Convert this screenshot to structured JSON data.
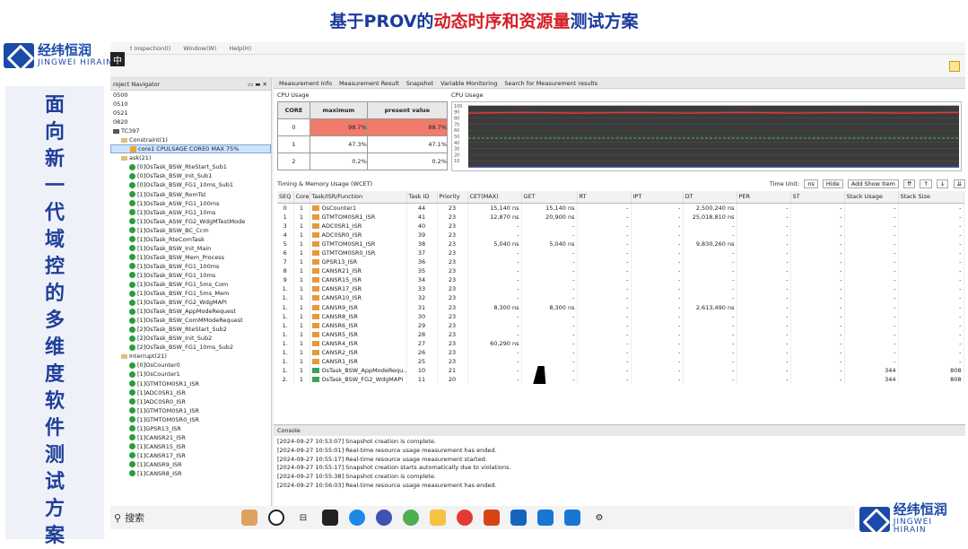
{
  "banner": {
    "part1": "基于PROV的",
    "part2": "动态时序和资源量",
    "part3": "测试方案"
  },
  "logo": {
    "cn": "经纬恒润",
    "en": "JINGWEI HIRAIN"
  },
  "ime": "中",
  "side_title": [
    "面",
    "向",
    "新",
    "一",
    "代",
    "域",
    "控",
    "的",
    "多",
    "维",
    "度",
    "软",
    "件",
    "测",
    "试",
    "方",
    "案"
  ],
  "menubar": [
    "t Inspection(I)",
    "Window(W)",
    "Help(H)"
  ],
  "navigator": {
    "title": "roject Navigator",
    "items": [
      {
        "label": "0500",
        "indent": 0,
        "icon": "none"
      },
      {
        "label": "0510",
        "indent": 0,
        "icon": "none"
      },
      {
        "label": "0521",
        "indent": 0,
        "icon": "none"
      },
      {
        "label": "0820",
        "indent": 0,
        "icon": "none"
      },
      {
        "label": "TC397",
        "indent": 0,
        "icon": "chip"
      },
      {
        "label": "Constraint(1)",
        "indent": 1,
        "icon": "folder"
      },
      {
        "label": "core1 CPULSAGE CORE0 MAX 75%",
        "indent": 2,
        "icon": "warn",
        "selected": true
      },
      {
        "label": "ask(21)",
        "indent": 1,
        "icon": "folder"
      },
      {
        "label": "[0]OsTask_BSW_RteStart_Sub1",
        "indent": 2,
        "icon": "check"
      },
      {
        "label": "[0]OsTask_BSW_Init_Sub1",
        "indent": 2,
        "icon": "check"
      },
      {
        "label": "[0]OsTask_BSW_FG1_10ms_Sub1",
        "indent": 2,
        "icon": "check"
      },
      {
        "label": "[1]OsTask_BSW_RomTst",
        "indent": 2,
        "icon": "check"
      },
      {
        "label": "[1]OsTask_ASW_FG1_100ms",
        "indent": 2,
        "icon": "check"
      },
      {
        "label": "[1]OsTask_ASW_FG1_10ms",
        "indent": 2,
        "icon": "check"
      },
      {
        "label": "[1]OsTask_ASW_FG2_WdgMTestMode",
        "indent": 2,
        "icon": "check"
      },
      {
        "label": "[1]OsTask_BSW_BC_Ccm",
        "indent": 2,
        "icon": "check"
      },
      {
        "label": "[1]OsTask_RteComTask",
        "indent": 2,
        "icon": "check"
      },
      {
        "label": "[1]OsTask_BSW_Init_Main",
        "indent": 2,
        "icon": "check"
      },
      {
        "label": "[1]OsTask_BSW_Mem_Process",
        "indent": 2,
        "icon": "check"
      },
      {
        "label": "[1]OsTask_BSW_FG1_100ms",
        "indent": 2,
        "icon": "check"
      },
      {
        "label": "[1]OsTask_BSW_FG1_10ms",
        "indent": 2,
        "icon": "check"
      },
      {
        "label": "[1]OsTask_BSW_FG1_5ms_Com",
        "indent": 2,
        "icon": "check"
      },
      {
        "label": "[1]OsTask_BSW_FG1_5ms_Mem",
        "indent": 2,
        "icon": "check"
      },
      {
        "label": "[1]OsTask_BSW_FG2_WdgMAPI",
        "indent": 2,
        "icon": "check"
      },
      {
        "label": "[1]OsTask_BSW_AppModeRequest",
        "indent": 2,
        "icon": "check"
      },
      {
        "label": "[1]OsTask_BSW_ComMModeRequest",
        "indent": 2,
        "icon": "check"
      },
      {
        "label": "[2]OsTask_BSW_RteStart_Sub2",
        "indent": 2,
        "icon": "check"
      },
      {
        "label": "[2]OsTask_BSW_Init_Sub2",
        "indent": 2,
        "icon": "check"
      },
      {
        "label": "[2]OsTask_BSW_FG1_10ms_Sub2",
        "indent": 2,
        "icon": "check"
      },
      {
        "label": "Interrupt(21)",
        "indent": 1,
        "icon": "folder"
      },
      {
        "label": "[0]OsCounter0",
        "indent": 2,
        "icon": "check"
      },
      {
        "label": "[1]OsCounter1",
        "indent": 2,
        "icon": "check"
      },
      {
        "label": "[1]GTMTOM0SR1_ISR",
        "indent": 2,
        "icon": "check"
      },
      {
        "label": "[1]ADC0SR1_ISR",
        "indent": 2,
        "icon": "check"
      },
      {
        "label": "[1]ADC0SR0_ISR",
        "indent": 2,
        "icon": "check"
      },
      {
        "label": "[1]GTMTOM0SR1_ISR",
        "indent": 2,
        "icon": "check"
      },
      {
        "label": "[1]GTMTOM0SR0_ISR",
        "indent": 2,
        "icon": "check"
      },
      {
        "label": "[1]GPSR13_ISR",
        "indent": 2,
        "icon": "check"
      },
      {
        "label": "[1]CANSR21_ISR",
        "indent": 2,
        "icon": "check"
      },
      {
        "label": "[1]CANSR15_ISR",
        "indent": 2,
        "icon": "check"
      },
      {
        "label": "[1]CANSR17_ISR",
        "indent": 2,
        "icon": "check"
      },
      {
        "label": "[1]CANSR9_ISR",
        "indent": 2,
        "icon": "check"
      },
      {
        "label": "[1]CANSR8_ISR",
        "indent": 2,
        "icon": "check"
      }
    ]
  },
  "tabs": [
    "Measurement Info",
    "Measurement Result",
    "Snapshot",
    "Variable Monitoring",
    "Search for Measurement results"
  ],
  "cpu_usage": {
    "title": "CPU Usage",
    "headers": [
      "CORE",
      "maximum",
      "present value"
    ],
    "rows": [
      {
        "core": "0",
        "max": "98.7%",
        "present": "88.7%",
        "alert": true
      },
      {
        "core": "1",
        "max": "47.3%",
        "present": "47.1%",
        "alert": false
      },
      {
        "core": "2",
        "max": "0.2%",
        "present": "0.2%",
        "alert": false
      }
    ]
  },
  "cpu_chart": {
    "title": "CPU Usage",
    "yticks": [
      "100",
      "90",
      "80",
      "70",
      "60",
      "50",
      "40",
      "30",
      "20",
      "10"
    ]
  },
  "chart_data": {
    "type": "line",
    "ylim": [
      0,
      100
    ],
    "series": [
      {
        "values": [
          88,
          89,
          88,
          89,
          88,
          89,
          88,
          89,
          88,
          89
        ]
      },
      {
        "values": [
          47,
          47,
          47,
          47,
          47,
          47,
          47,
          47,
          47,
          47
        ]
      },
      {
        "values": [
          0,
          0,
          0,
          0,
          0,
          0,
          0,
          0,
          0,
          0
        ]
      }
    ],
    "colors": [
      "#e53935",
      "#43a047",
      "#3949ab"
    ]
  },
  "wcet": {
    "title": "Timing & Memory Usage (WCET)",
    "time_unit_label": "Time Unit:",
    "time_unit": "ns",
    "hide_label": "Hide",
    "add_show_label": "Add Show Item",
    "headers": [
      "SEQ",
      "Core",
      "Task/ISR/Function",
      "Task ID",
      "Priority",
      "CET(MAX)",
      "GET",
      "RT",
      "IPT",
      "DT",
      "PER",
      "ST",
      "Stack Usage",
      "Stack Size"
    ],
    "rows": [
      [
        "0",
        "1",
        "OsCounter1",
        "44",
        "23",
        "15,140 ns",
        "15,140 ns",
        "-",
        "-",
        "2,500,240 ns",
        "-",
        "-",
        "-",
        "-"
      ],
      [
        "1",
        "1",
        "GTMTOM0SR1_ISR",
        "41",
        "23",
        "12,870 ns",
        "20,900 ns",
        "-",
        "-",
        "25,018,810 ns",
        "-",
        "-",
        "-",
        "-"
      ],
      [
        "3",
        "1",
        "ADC0SR1_ISR",
        "40",
        "23",
        "-",
        "-",
        "-",
        "-",
        "-",
        "-",
        "-",
        "-",
        "-"
      ],
      [
        "4",
        "1",
        "ADC0SR0_ISR",
        "39",
        "23",
        "-",
        "-",
        "-",
        "-",
        "-",
        "-",
        "-",
        "-",
        "-"
      ],
      [
        "5",
        "1",
        "GTMTOM0SR1_ISR",
        "38",
        "23",
        "5,040 ns",
        "5,040 ns",
        "-",
        "-",
        "9,830,260 ns",
        "-",
        "-",
        "-",
        "-"
      ],
      [
        "6",
        "1",
        "GTMTOM0SR0_ISR",
        "37",
        "23",
        "-",
        "-",
        "-",
        "-",
        "-",
        "-",
        "-",
        "-",
        "-"
      ],
      [
        "7",
        "1",
        "GPSR13_ISR",
        "36",
        "23",
        "-",
        "-",
        "-",
        "-",
        "-",
        "-",
        "-",
        "-",
        "-"
      ],
      [
        "8",
        "1",
        "CANSR21_ISR",
        "35",
        "23",
        "-",
        "-",
        "-",
        "-",
        "-",
        "-",
        "-",
        "-",
        "-"
      ],
      [
        "9",
        "1",
        "CANSR15_ISR",
        "34",
        "23",
        "-",
        "-",
        "-",
        "-",
        "-",
        "-",
        "-",
        "-",
        "-"
      ],
      [
        "1.",
        "1",
        "CANSR17_ISR",
        "33",
        "23",
        "-",
        "-",
        "-",
        "-",
        "-",
        "-",
        "-",
        "-",
        "-"
      ],
      [
        "1.",
        "1",
        "CANSR10_ISR",
        "32",
        "23",
        "-",
        "-",
        "-",
        "-",
        "-",
        "-",
        "-",
        "-",
        "-"
      ],
      [
        "1.",
        "1",
        "CANSR9_ISR",
        "31",
        "23",
        "8,300 ns",
        "8,300 ns",
        "-",
        "-",
        "2,613,490 ns",
        "-",
        "-",
        "-",
        "-"
      ],
      [
        "1.",
        "1",
        "CANSR8_ISR",
        "30",
        "23",
        "-",
        "-",
        "-",
        "-",
        "-",
        "-",
        "-",
        "-",
        "-"
      ],
      [
        "1.",
        "1",
        "CANSR6_ISR",
        "29",
        "23",
        "-",
        "-",
        "-",
        "-",
        "-",
        "-",
        "-",
        "-",
        "-"
      ],
      [
        "1.",
        "1",
        "CANSR5_ISR",
        "28",
        "23",
        "-",
        "-",
        "-",
        "-",
        "-",
        "-",
        "-",
        "-",
        "-"
      ],
      [
        "1.",
        "1",
        "CANSR4_ISR",
        "27",
        "23",
        "60,290 ns",
        "-",
        "-",
        "-",
        "-",
        "-",
        "-",
        "-",
        "-"
      ],
      [
        "1.",
        "1",
        "CANSR2_ISR",
        "26",
        "23",
        "-",
        "-",
        "-",
        "-",
        "-",
        "-",
        "-",
        "-",
        "-"
      ],
      [
        "1.",
        "1",
        "CANSR1_ISR",
        "25",
        "23",
        "-",
        "-",
        "-",
        "-",
        "-",
        "-",
        "-",
        "-",
        "-"
      ],
      [
        "1.",
        "1",
        "OsTask_BSW_AppModeRequ...",
        "10",
        "21",
        "-",
        "-",
        "-",
        "-",
        "-",
        "-",
        "-",
        "344",
        "808"
      ],
      [
        "2.",
        "1",
        "OsTask_BSW_FG2_WdgMAPI",
        "11",
        "20",
        "-",
        "-",
        "-",
        "-",
        "-",
        "-",
        "-",
        "344",
        "808"
      ]
    ]
  },
  "console": {
    "title": "Console",
    "lines": [
      "[2024-09-27 10:53:07] Snapshot creation is complete.",
      "[2024-09-27 10:55:01] Real-time resource usage measurement has ended.",
      "[2024-09-27 10:55:17] Real-time resource usage measurement started.",
      "[2024-09-27 10:55:17] Snapshot creation starts automatically due to violations.",
      "[2024-09-27 10:55:38] Snapshot creation is complete.",
      "[2024-09-27 10:56:03] Real-time resource usage measurement has ended."
    ]
  },
  "taskbar": {
    "search_label": "搜索"
  }
}
